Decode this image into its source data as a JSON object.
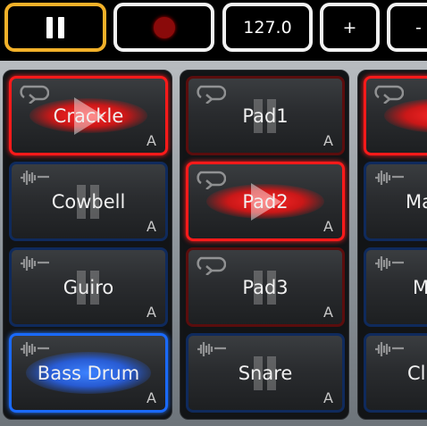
{
  "toolbar": {
    "bpm_value": "127.0",
    "plus_label": "+",
    "minus_label": "-"
  },
  "columns": [
    {
      "pads": [
        {
          "label": "Crackle",
          "key": "A",
          "state": "playing",
          "icon": "loop-icon"
        },
        {
          "label": "Cowbell",
          "key": "A",
          "state": "paused",
          "icon": "waveform-icon"
        },
        {
          "label": "Guiro",
          "key": "A",
          "state": "paused",
          "icon": "waveform-icon"
        },
        {
          "label": "Bass Drum",
          "key": "A",
          "state": "triggered",
          "icon": "waveform-icon"
        }
      ]
    },
    {
      "pads": [
        {
          "label": "Pad1",
          "key": "A",
          "state": "paused",
          "icon": "loop-icon"
        },
        {
          "label": "Pad2",
          "key": "A",
          "state": "playing",
          "icon": "loop-icon"
        },
        {
          "label": "Pad3",
          "key": "A",
          "state": "paused",
          "icon": "loop-icon"
        },
        {
          "label": "Snare",
          "key": "A",
          "state": "paused",
          "icon": "waveform-icon"
        }
      ]
    },
    {
      "pads": [
        {
          "label": "",
          "key": "",
          "state": "playing",
          "icon": "loop-icon"
        },
        {
          "label": "Ma",
          "key": "",
          "state": "idle",
          "icon": "waveform-icon"
        },
        {
          "label": "M",
          "key": "",
          "state": "idle",
          "icon": "waveform-icon"
        },
        {
          "label": "Cl",
          "key": "",
          "state": "idle",
          "icon": "waveform-icon"
        }
      ]
    }
  ],
  "colors": {
    "accent_orange": "#f2b129",
    "active_red": "#ff1a1a",
    "active_blue": "#1a6aff",
    "record_red": "#8a0a0a"
  }
}
